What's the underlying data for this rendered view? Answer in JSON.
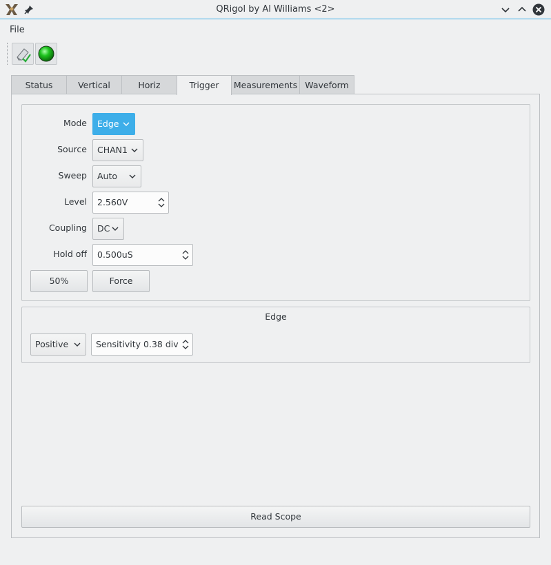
{
  "window": {
    "title": "QRigol by Al Williams <2>"
  },
  "menu": {
    "file": "File"
  },
  "tabs": [
    {
      "label": "Status"
    },
    {
      "label": "Vertical"
    },
    {
      "label": "Horiz"
    },
    {
      "label": "Trigger"
    },
    {
      "label": "Measurements"
    },
    {
      "label": "Waveform"
    }
  ],
  "active_tab": "Trigger",
  "trigger": {
    "mode_label": "Mode",
    "mode_value": "Edge",
    "source_label": "Source",
    "source_value": "CHAN1",
    "sweep_label": "Sweep",
    "sweep_value": "Auto",
    "level_label": "Level",
    "level_value": "2.560V",
    "coupling_label": "Coupling",
    "coupling_value": "DC",
    "holdoff_label": "Hold off",
    "holdoff_value": "0.500uS",
    "fifty_label": "50%",
    "force_label": "Force"
  },
  "edge": {
    "title": "Edge",
    "slope_value": "Positive",
    "sensitivity_value": "Sensitivity 0.38 div"
  },
  "read_scope_label": "Read Scope",
  "colors": {
    "accent": "#3daee9",
    "status_led": "#1ec31e",
    "background": "#eff0f1"
  },
  "icons": [
    "app-icon",
    "pin-icon",
    "minimize-icon",
    "maximize-icon",
    "close-icon",
    "clear-icon",
    "connect-led-icon"
  ]
}
